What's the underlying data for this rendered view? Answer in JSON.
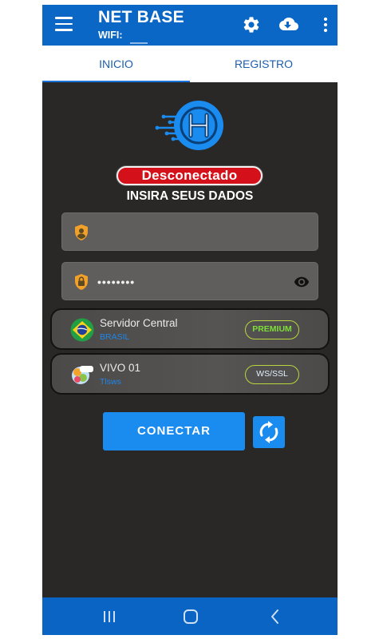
{
  "app": {
    "title": "NET BASE",
    "wifi_label": "WIFI:"
  },
  "icons": {
    "menu": "hamburger-menu-icon",
    "settings": "gear-icon",
    "cloud": "cloud-download-icon",
    "more": "more-vert-icon"
  },
  "tabs": [
    {
      "label": "INICIO",
      "selected": true
    },
    {
      "label": "REGISTRO",
      "selected": false
    }
  ],
  "status": {
    "label": "Desconectado",
    "color": "#d4111b"
  },
  "prompt": "INSIRA SEUS DADOS",
  "form": {
    "username_value": "",
    "password_value": "••••••••"
  },
  "servers": [
    {
      "name": "Servidor Central",
      "region": "BRASIL",
      "badge": "PREMIUM",
      "flag": "brazil-flag-icon"
    },
    {
      "name": "VIVO 01",
      "region": "Tlsws",
      "badge": "WS/SSL",
      "flag": "vivo-logo-icon"
    }
  ],
  "connect_label": "CONECTAR",
  "colors": {
    "primary": "#0b67c6",
    "accent": "#1a8cf0",
    "background": "#2a2826"
  }
}
